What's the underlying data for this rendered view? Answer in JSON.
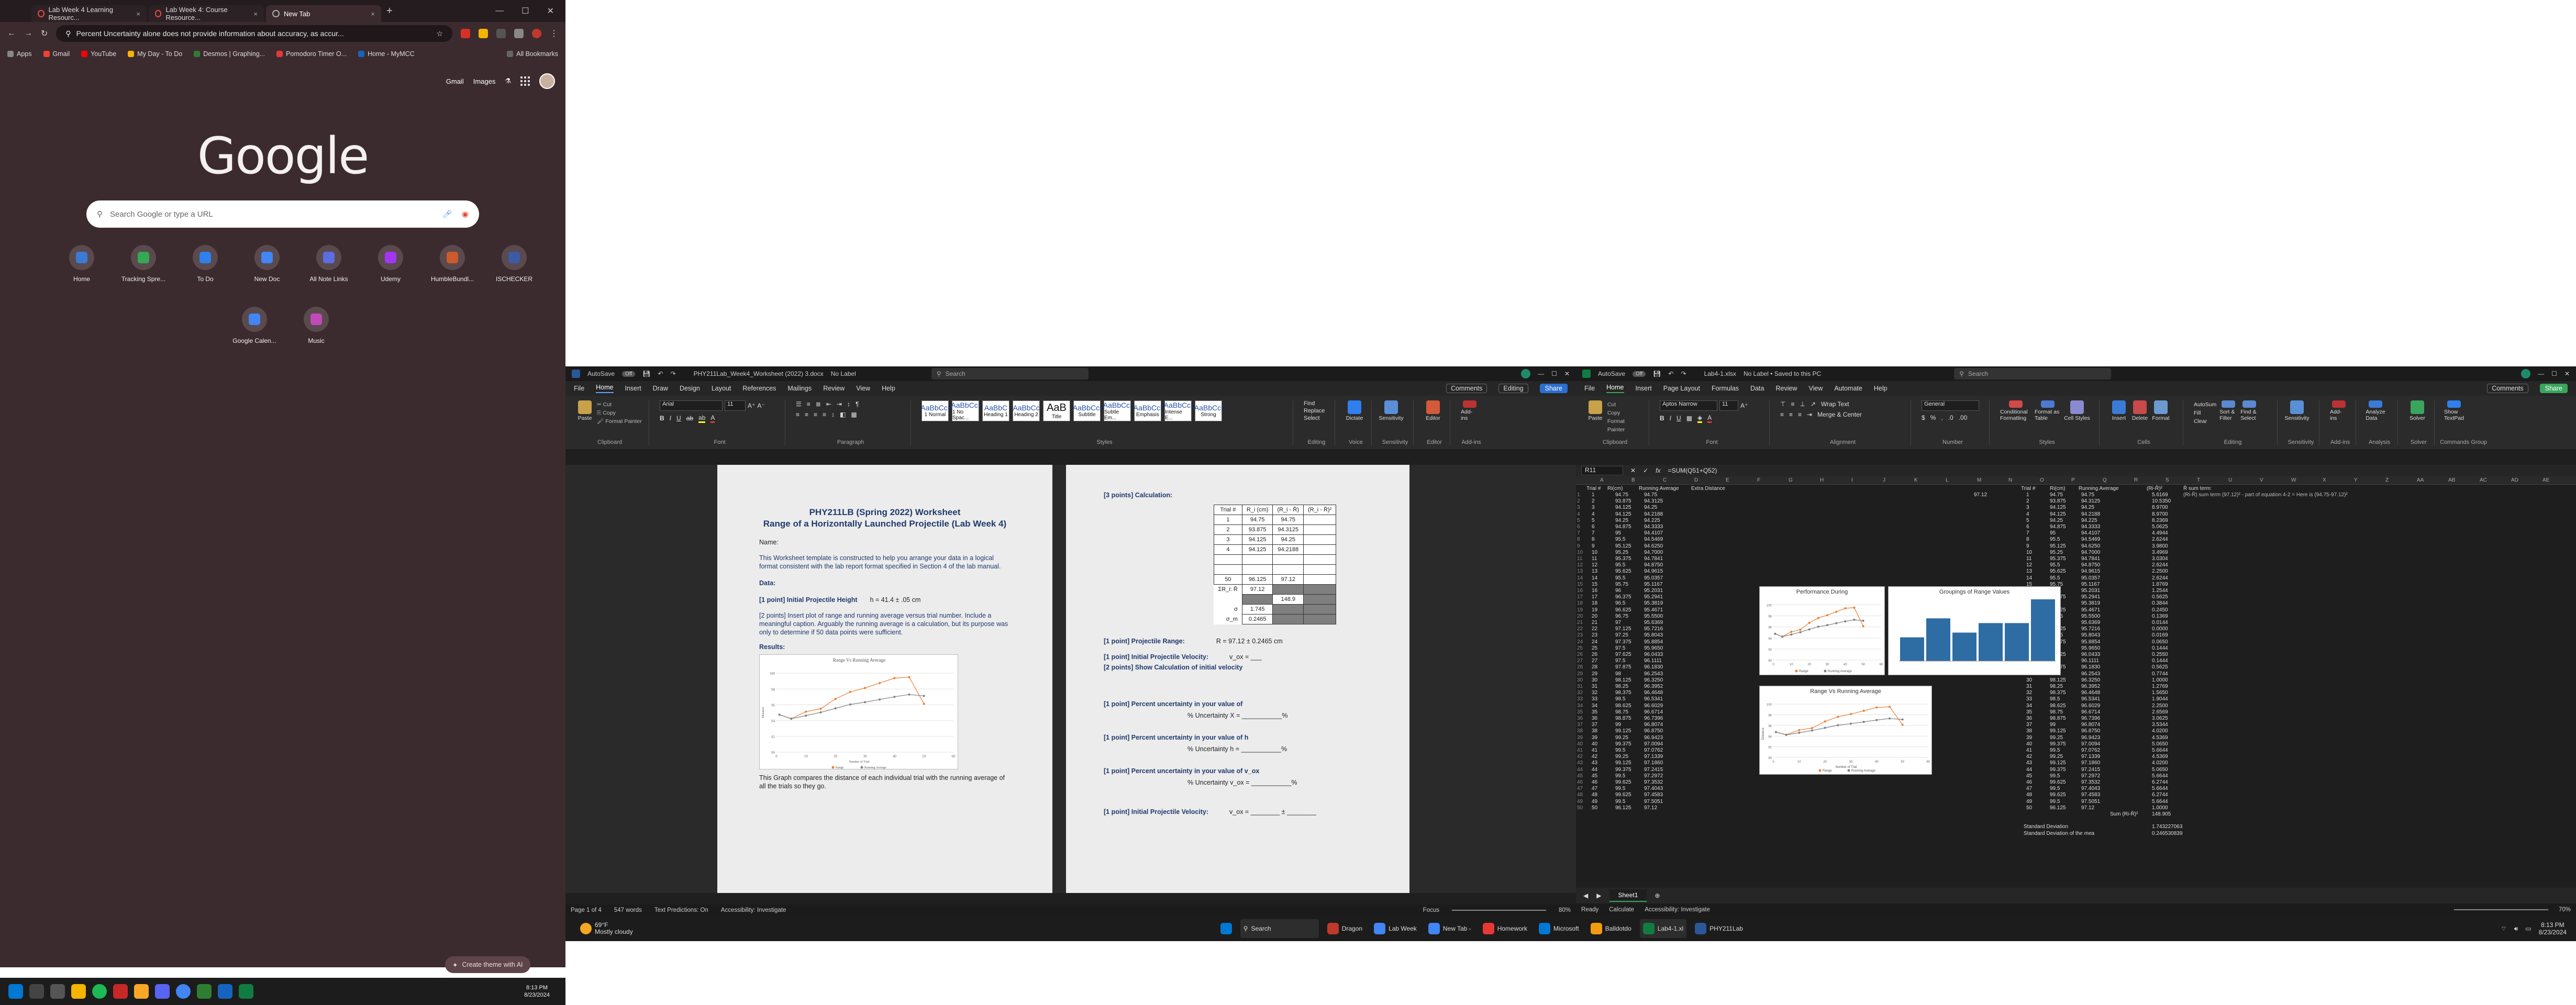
{
  "chrome": {
    "tabs": [
      {
        "label": "Lab Week 4 Learning Resourc...",
        "active": false
      },
      {
        "label": "Lab Week 4: Course Resource...",
        "active": false
      },
      {
        "label": "New Tab",
        "active": true
      }
    ],
    "new_tab": "+",
    "address": "Percent Uncertainty alone does not provide information about accuracy, as accur...",
    "bookmarks": [
      "Apps",
      "Gmail",
      "YouTube",
      "My Day - To Do",
      "Desmos | Graphing...",
      "Pomodoro Timer O...",
      "Home - MyMCC"
    ],
    "all_bookmarks": "All Bookmarks",
    "gmail": "Gmail",
    "images": "Images",
    "logo": "Google",
    "search_placeholder": "Search Google or type a URL",
    "shortcuts": [
      {
        "label": "Home",
        "color": "#3a7bd5"
      },
      {
        "label": "Tracking Spre...",
        "color": "#34a853"
      },
      {
        "label": "To Do",
        "color": "#2f80ed"
      },
      {
        "label": "New Doc",
        "color": "#4285f4"
      },
      {
        "label": "All Note Links",
        "color": "#5b6ee1"
      },
      {
        "label": "Udemy",
        "color": "#a435f0"
      },
      {
        "label": "HumbleBundl...",
        "color": "#cc5a2a"
      },
      {
        "label": "ISCHECKER",
        "color": "#3c5aa6"
      },
      {
        "label": "Google Calen...",
        "color": "#4285f4"
      },
      {
        "label": "Music",
        "color": "#c04ab8"
      }
    ],
    "customize": "Create theme with AI"
  },
  "left_taskbar": {
    "time": "8:13 PM",
    "date": "8/23/2024"
  },
  "word": {
    "autosave": "AutoSave",
    "autosave_state": "Off",
    "filename": "PHY211Lab_Week4_Worksheet (2022) 3.docx",
    "label": "No Label",
    "search": "Search",
    "menu": [
      "File",
      "Home",
      "Insert",
      "Draw",
      "Design",
      "Layout",
      "References",
      "Mailings",
      "Review",
      "View",
      "Help"
    ],
    "comments": "Comments",
    "editing": "Editing",
    "share": "Share",
    "font": "Arial",
    "size": "11",
    "groups": [
      "Clipboard",
      "Font",
      "Paragraph",
      "Styles",
      "Editing",
      "Voice",
      "Sensitivity",
      "Editor",
      "Add-ins"
    ],
    "styles": [
      [
        "AaBbCcI",
        "1 Normal"
      ],
      [
        "AaBbCcI",
        "1 No Spac..."
      ],
      [
        "AaBbC",
        "Heading 1"
      ],
      [
        "AaBbCc",
        "Heading 2"
      ],
      [
        "AaB",
        "Title"
      ],
      [
        "AaBbCcl",
        "Subtitle"
      ],
      [
        "AaBbCcl",
        "Subtle Em..."
      ],
      [
        "AaBbCcl",
        "Emphasis"
      ],
      [
        "AaBbCcl",
        "Intense E..."
      ],
      [
        "AaBbCcl",
        "Strong"
      ]
    ],
    "editing_items": [
      "Find",
      "Replace",
      "Select"
    ],
    "ribbon_right": [
      "Dictate",
      "Sensitivity",
      "Editor",
      "Add-ins"
    ],
    "page1": {
      "title1": "PHY211LB (Spring 2022) Worksheet",
      "title2": "Range of a Horizontally Launched Projectile (Lab Week 4)",
      "name": "Name:",
      "intro": "This Worksheet template is constructed to help you arrange your data in a logical format consistent with the lab report format specified in Section 4 of the lab manual.",
      "data": "Data:",
      "height": "[1 point] Initial Projectile Height",
      "height_val": "h = 41.4 ± .05 cm",
      "insert": "[2 points] Insert plot of range and running average versus trial number.  Include a meaningful caption.  Arguably the running average is a calculation, but its purpose was only to determine if 50 data points were sufficient.",
      "results": "Results:",
      "chart_title": "Range Vs Running Average",
      "chart_xlabel": "Number of Trial",
      "chart_ylabel": "Distance",
      "legend": [
        "Range",
        "Running Average"
      ],
      "caption": "This Graph compares the distance of each individual trial with the running average of all the trials so they go."
    },
    "page2": {
      "calc": "[3 points] Calculation:",
      "table_headers": [
        "Trial #",
        "R_i (cm)",
        "(R_i - R̄)",
        "(R_i - R̄)²"
      ],
      "table_rows": [
        [
          "1",
          "94.75",
          "94.75"
        ],
        [
          "2",
          "93.875",
          "94.3125"
        ],
        [
          "3",
          "94.125",
          "94.25"
        ],
        [
          "4",
          "94.125",
          "94.2188"
        ],
        [
          "",
          "",
          ""
        ],
        [
          "",
          "",
          ""
        ],
        [
          "50",
          "96.125",
          "97.12"
        ]
      ],
      "sum_label": "ΣR_i:  R̄",
      "sum_vals": [
        "97.12",
        "148.9"
      ],
      "extra_vals": [
        "1.745",
        "0.2465"
      ],
      "sigma": "σ",
      "sigma_m": "σ_m",
      "range": "[1 point] Projectile Range:",
      "range_val": "R = 97.12 ± 0.2465 cm",
      "vel": "[1 point] Initial Projectile Velocity:",
      "vel_eq": "v_ox = ___",
      "show": "[2 points] Show Calculation of initial velocity",
      "pct1": "[1 point] Percent uncertainty in your value of",
      "pct1_eq": "% Uncertainty  X = ___________%",
      "pct2": "[1 point] Percent uncertainty in your value of h",
      "pct2_eq": "% Uncertainty  h = ___________%",
      "pct3": "[1 point] Percent uncertainty in your value of v_ox",
      "pct3_eq": "% Uncertainty  v_ox = ___________%",
      "final": "[1 point] Initial Projectile Velocity:",
      "final_eq": "v_ox = ________ ± ________"
    },
    "status": [
      "Page 1 of 4",
      "547 words",
      "Text Predictions: On",
      "Accessibility: Investigate"
    ],
    "status_right": [
      "Focus",
      "80%"
    ]
  },
  "excel": {
    "autosave": "AutoSave",
    "autosave_state": "Off",
    "filename": "Lab4-1.xlsx",
    "label": "No Label • Saved to this PC",
    "search": "Search",
    "menu": [
      "File",
      "Home",
      "Insert",
      "Page Layout",
      "Formulas",
      "Data",
      "Review",
      "View",
      "Automate",
      "Help"
    ],
    "comments": "Comments",
    "share": "Share",
    "font": "Aptos Narrow",
    "size": "11",
    "number_format": "General",
    "groups": [
      "Clipboard",
      "Font",
      "Alignment",
      "Number",
      "Styles",
      "Cells",
      "Editing",
      "Sensitivity",
      "Add-ins",
      "Analysis",
      "Solver",
      "Commands Group"
    ],
    "clip_items": [
      "Cut",
      "Copy",
      "Format Painter"
    ],
    "wrap": "Wrap Text",
    "merge": "Merge & Center",
    "style_items": [
      "Conditional Formatting",
      "Format as Table",
      "Cell Styles"
    ],
    "cell_items": [
      "Insert",
      "Delete",
      "Format"
    ],
    "edit_items": [
      "AutoSum",
      "Fill",
      "Clear",
      "Sort & Filter",
      "Find & Select"
    ],
    "right_items": [
      "Sensitivity",
      "Add-ins",
      "Analyze Data",
      "Solver",
      "Show TextPad"
    ],
    "namebox": "R11",
    "formula": "=SUM(Q51+Q52)",
    "col_headers": [
      "A",
      "B",
      "C",
      "D",
      "E",
      "F",
      "G",
      "H",
      "I",
      "J",
      "K",
      "L",
      "M",
      "N",
      "O",
      "P",
      "Q",
      "R",
      "S",
      "T",
      "U",
      "V",
      "W",
      "X",
      "Y",
      "Z",
      "AA",
      "AB",
      "AC",
      "AD",
      "AE"
    ],
    "headers_left": [
      "Trial #",
      "Ri(cm)",
      "Running Average",
      "Extra Distance"
    ],
    "headers_right": [
      "Trial #",
      "Ri(cm)",
      "Running Average",
      "(Ri-R̄)²",
      "R̄ sum term:"
    ],
    "note": "(Ri-R̄) sum term (97.12)² - part of equation 4-2 = Here is (94.75-97.12)²",
    "left_ri": [
      "94.75",
      "93.875",
      "94.125",
      "94.125",
      "94.25",
      "94.875",
      "95",
      "95.5",
      "95.125",
      "95.25",
      "95.375",
      "95.5",
      "95.625",
      "95.5",
      "95.75",
      "96",
      "96.375",
      "96.5",
      "96.625",
      "96.75",
      "97",
      "97.125",
      "97.25",
      "97.375",
      "97.5",
      "97.625",
      "97.5",
      "97.875",
      "98",
      "98.125",
      "98.25",
      "98.375",
      "98.5",
      "98.625",
      "98.75",
      "98.875",
      "99",
      "99.125",
      "99.25",
      "99.375",
      "99.5",
      "99.25",
      "99.125",
      "99.375",
      "99.5",
      "99.625",
      "99.5",
      "99.625",
      "99.5",
      "96.125"
    ],
    "left_avg": [
      "94.75",
      "94.3125",
      "94.25",
      "94.2188",
      "94.225",
      "94.3333",
      "94.4107",
      "94.5469",
      "94.6250",
      "94.7000",
      "94.7841",
      "94.8750",
      "94.9615",
      "95.0357",
      "95.1167",
      "95.2031",
      "95.2941",
      "95.3819",
      "95.4671",
      "95.5500",
      "95.6369",
      "95.7216",
      "95.8043",
      "95.8854",
      "95.9650",
      "96.0433",
      "96.1111",
      "96.1830",
      "96.2543",
      "96.3250",
      "96.3952",
      "96.4648",
      "96.5341",
      "96.6029",
      "96.6714",
      "96.7396",
      "96.8074",
      "96.8750",
      "96.9423",
      "97.0094",
      "97.0762",
      "97.1339",
      "97.1860",
      "97.2415",
      "97.2972",
      "97.3532",
      "97.4043",
      "97.4583",
      "97.5051",
      "97.12"
    ],
    "right_sq": [
      "5.6169",
      "10.5350",
      "8.9700",
      "8.9700",
      "8.2369",
      "5.0625",
      "4.4944",
      "2.6244",
      "3.9800",
      "3.4969",
      "3.0304",
      "2.6244",
      "2.2500",
      "2.6244",
      "1.8769",
      "1.2544",
      "0.5625",
      "0.3844",
      "0.2450",
      "0.1369",
      "0.0144",
      "0.0000",
      "0.0169",
      "0.0650",
      "0.1444",
      "0.2550",
      "0.1444",
      "0.5625",
      "0.7744",
      "1.0000",
      "1.2769",
      "1.5650",
      "1.9044",
      "2.2500",
      "2.6569",
      "3.0625",
      "3.5344",
      "4.0200",
      "4.5369",
      "5.0650",
      "5.6644",
      "4.5369",
      "4.0200",
      "5.0650",
      "5.6644",
      "6.2744",
      "5.6644",
      "6.2744",
      "5.6644",
      "1.0000"
    ],
    "sum_label": "Sum (Ri-R̄)²",
    "sum_val": "148.905",
    "total": "97.12",
    "std_dev_label": "Standard Deviation",
    "std_dev_val": "1.743227063",
    "std_mean_label": "Standard Deviation of the mea",
    "std_mean_val": "0.246530839",
    "chart1_title": "Performance During",
    "chart2_title": "Groupings of Range Values",
    "chart3_title": "Range Vs Running Average",
    "chart3_xlabel": "Number of Trial",
    "chart3_ylabel": "Distance",
    "chart_legend": [
      "Range",
      "Running Average"
    ],
    "sheet": "Sheet1",
    "status": [
      "Ready",
      "Calculate",
      "Accessibility: Investigate"
    ],
    "zoom": "70%"
  },
  "right_taskbar": {
    "search": "Search",
    "apps": [
      "Dragon",
      "Lab Week",
      "New Tab -",
      "Homework",
      "Microsoft",
      "Balldotdo",
      "Lab4-1.xl",
      "PHY211Lab"
    ],
    "weather_temp": "69°F",
    "weather_desc": "Mostly cloudy",
    "time": "8:13 PM",
    "date": "8/23/2024"
  },
  "chart_data": [
    {
      "type": "line",
      "title": "Range Vs Running Average",
      "xlabel": "Number of Trial",
      "ylabel": "Distance",
      "x": [
        1,
        5,
        10,
        15,
        20,
        25,
        30,
        35,
        40,
        45,
        50
      ],
      "series": [
        {
          "name": "Range",
          "values": [
            94.75,
            94.25,
            95.125,
            95.5,
            96.75,
            97.625,
            98.125,
            98.75,
            99.375,
            99.5,
            96.125
          ],
          "color": "#ed7d31"
        },
        {
          "name": "Running Average",
          "values": [
            94.75,
            94.23,
            94.63,
            95.04,
            95.55,
            96.04,
            96.33,
            96.67,
            97.01,
            97.3,
            97.12
          ],
          "color": "#7f7f7f"
        }
      ],
      "ylim": [
        90,
        101
      ],
      "xlim": [
        0,
        60
      ]
    }
  ]
}
